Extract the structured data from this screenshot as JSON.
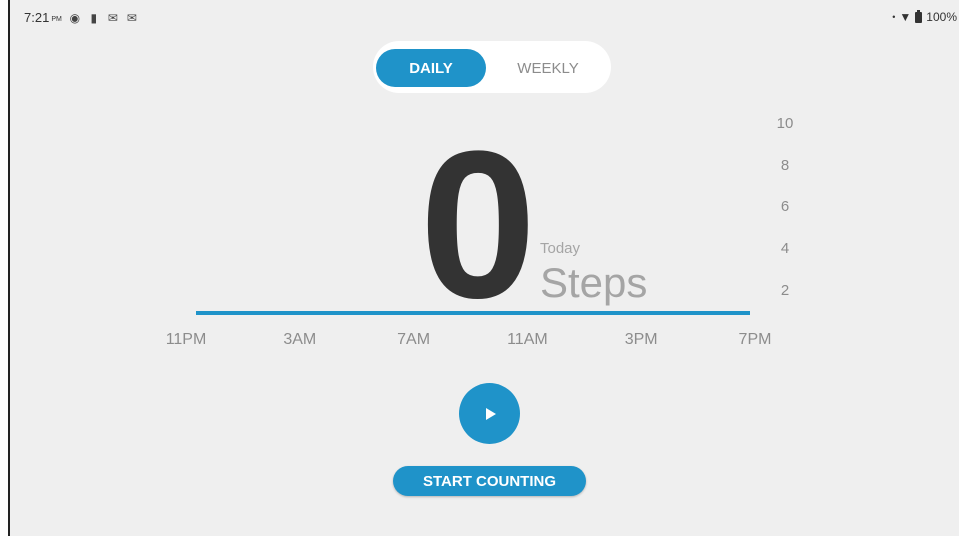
{
  "status_bar": {
    "time": "7:21",
    "ampm": "PM",
    "left_icons": [
      "sync-icon",
      "sd-card-icon",
      "gmail-icon",
      "gmail-icon"
    ],
    "battery_text": "100%"
  },
  "toggle": {
    "daily_label": "DAILY",
    "weekly_label": "WEEKLY",
    "selected": "DAILY"
  },
  "summary": {
    "count": "0",
    "period_label": "Today",
    "unit_label": "Steps"
  },
  "chart_data": {
    "type": "bar",
    "categories": [
      "11PM",
      "3AM",
      "7AM",
      "11AM",
      "3PM",
      "7PM"
    ],
    "values": [
      0,
      0,
      0,
      0,
      0,
      0
    ],
    "y_ticks": [
      "10",
      "8",
      "6",
      "4",
      "2"
    ],
    "ylim": [
      0,
      10
    ],
    "color": "#1f93c9"
  },
  "actions": {
    "start_label": "START COUNTING"
  },
  "colors": {
    "accent": "#1f93c9",
    "background": "#efefef",
    "text_dark": "#333333",
    "text_muted": "#8c8c8c"
  }
}
